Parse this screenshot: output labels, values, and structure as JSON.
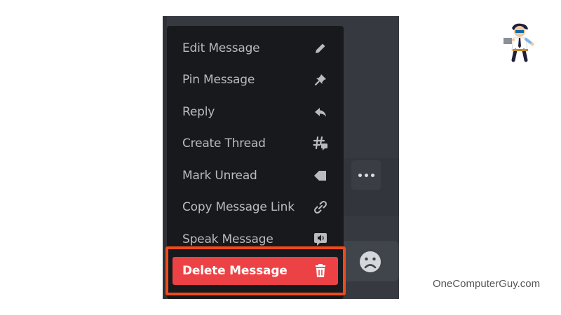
{
  "context_menu": {
    "items": [
      {
        "label": "Edit Message",
        "icon": "pencil-icon"
      },
      {
        "label": "Pin Message",
        "icon": "pin-icon"
      },
      {
        "label": "Reply",
        "icon": "reply-arrow-icon"
      },
      {
        "label": "Create Thread",
        "icon": "thread-icon"
      },
      {
        "label": "Mark Unread",
        "icon": "mark-unread-icon"
      },
      {
        "label": "Copy Message Link",
        "icon": "link-icon"
      },
      {
        "label": "Speak Message",
        "icon": "speak-icon"
      },
      {
        "label": "Delete Message",
        "icon": "trash-icon",
        "danger": true
      }
    ]
  },
  "message_toolbar": {
    "more_icon": "more-options-icon"
  },
  "chat_input": {
    "emoji_icon": "emoji-face-icon"
  },
  "watermark": {
    "text": "OneComputerGuy.com"
  },
  "colors": {
    "menu_bg": "#18191c",
    "panel_bg": "#36393f",
    "danger": "#ed4245",
    "highlight": "#f04a1c",
    "menu_text": "#b9bbbe"
  }
}
